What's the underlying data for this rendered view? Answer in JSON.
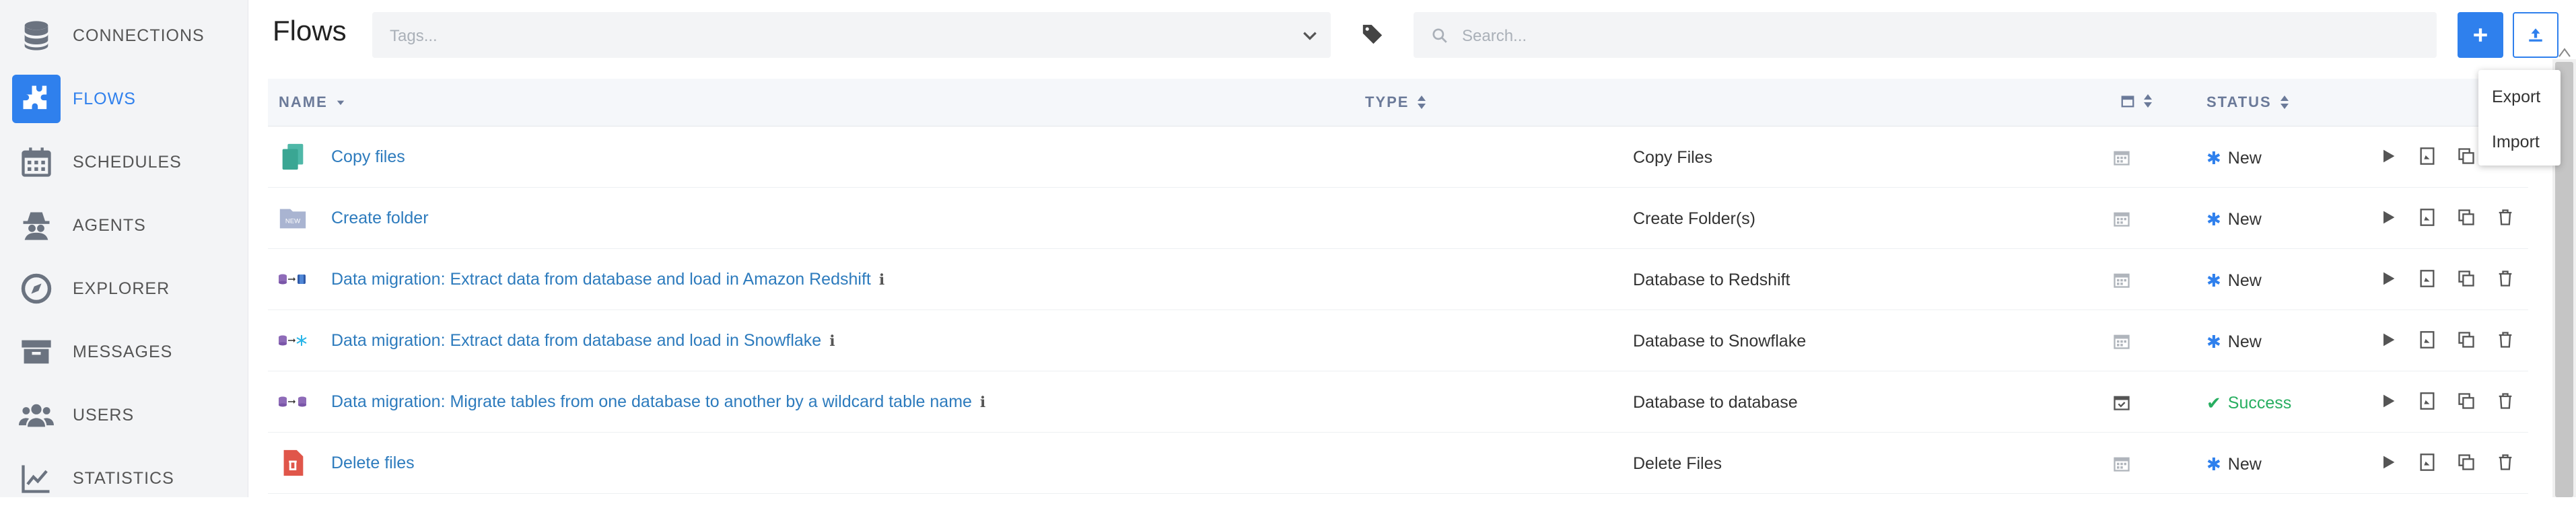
{
  "sidebar": {
    "items": [
      {
        "label": "CONNECTIONS",
        "icon": "database-icon"
      },
      {
        "label": "FLOWS",
        "icon": "puzzle-icon"
      },
      {
        "label": "SCHEDULES",
        "icon": "calendar-icon"
      },
      {
        "label": "AGENTS",
        "icon": "agent-spy-icon"
      },
      {
        "label": "EXPLORER",
        "icon": "compass-icon"
      },
      {
        "label": "MESSAGES",
        "icon": "archive-box-icon"
      },
      {
        "label": "USERS",
        "icon": "users-icon"
      },
      {
        "label": "STATISTICS",
        "icon": "line-chart-icon"
      }
    ],
    "active_index": 1
  },
  "header": {
    "title": "Flows",
    "tags_placeholder": "Tags...",
    "search_placeholder": "Search...",
    "accent_color": "#2f80ed"
  },
  "dropdown": {
    "items": [
      "Export",
      "Import"
    ]
  },
  "table": {
    "columns": {
      "name": "NAME",
      "type": "TYPE",
      "status": "STATUS"
    },
    "rows": [
      {
        "name": "Copy files",
        "type": "Copy Files",
        "status": "New",
        "icon": "copy-files-icon",
        "info": false
      },
      {
        "name": "Create folder",
        "type": "Create Folder(s)",
        "status": "New",
        "icon": "new-folder-icon",
        "info": false
      },
      {
        "name": "Data migration: Extract data from database and load in Amazon Redshift",
        "type": "Database to Redshift",
        "status": "New",
        "icon": "db-to-redshift-icon",
        "info": true
      },
      {
        "name": "Data migration: Extract data from database and load in Snowflake",
        "type": "Database to Snowflake",
        "status": "New",
        "icon": "db-to-snowflake-icon",
        "info": true
      },
      {
        "name": "Data migration: Migrate tables from one database to another by a wildcard table name",
        "type": "Database to database",
        "status": "Success",
        "icon": "db-to-db-icon",
        "info": true
      },
      {
        "name": "Delete files",
        "type": "Delete Files",
        "status": "New",
        "icon": "delete-files-icon",
        "info": false
      }
    ],
    "status_colors": {
      "New": "#2f80ed",
      "Success": "#27ae60"
    }
  }
}
